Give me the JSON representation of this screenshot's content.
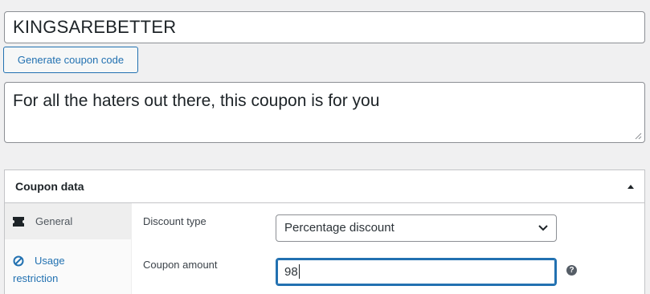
{
  "coupon": {
    "code_value": "KINGSAREBETTER",
    "generate_label": "Generate coupon code",
    "description_value": "For all the haters out there, this coupon is for you"
  },
  "panel": {
    "title": "Coupon data",
    "tabs": [
      {
        "label": "General",
        "icon": "ticket-icon",
        "active": true
      },
      {
        "label_line1": "Usage",
        "label_line2": "restriction",
        "icon": "no-entry-icon",
        "active": false
      }
    ],
    "fields": {
      "discount_type_label": "Discount type",
      "discount_type_value": "Percentage discount",
      "coupon_amount_label": "Coupon amount",
      "coupon_amount_value": "98",
      "help_glyph": "?"
    }
  },
  "colors": {
    "accent": "#2271b1",
    "page_bg": "#f0f0f1",
    "active_tab_bg": "#eeeeee"
  }
}
